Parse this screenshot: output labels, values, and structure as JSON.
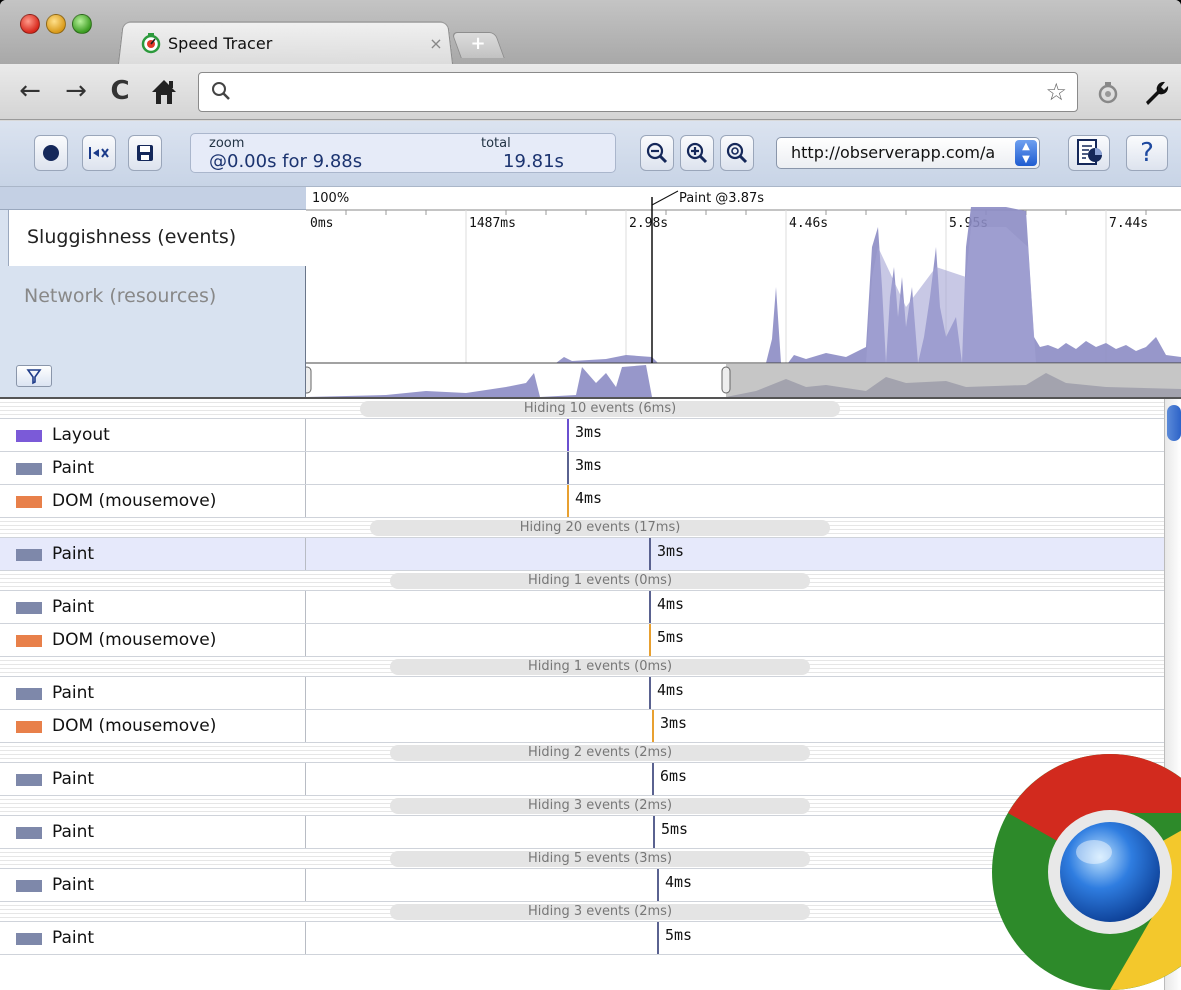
{
  "browser": {
    "tab_title": "Speed Tracer",
    "tab_close": "×",
    "new_tab": "+",
    "address_value": ""
  },
  "speedtracer": {
    "zoom_label": "zoom",
    "zoom_value": "@0.00s for 9.88s",
    "total_label": "total",
    "total_value": "19.81s",
    "url_value": "http://observerapp.com/a",
    "help_label": "?",
    "views": {
      "sluggishness": "Sluggishness (events)",
      "network": "Network (resources)"
    },
    "overview": {
      "percent_label": "100%",
      "marker_label": "Paint @3.87s",
      "ticks": [
        "0ms",
        "1487ms",
        "2.98s",
        "4.46s",
        "5.95s",
        "7.44s"
      ]
    },
    "colors": {
      "layout": "#7b5ad8",
      "paint": "#7e88aa",
      "dom": "#e8804a",
      "graph_fill": "#8c8cc4"
    }
  },
  "events": [
    {
      "kind": "hidden",
      "text": "Hiding 10 events (6ms)"
    },
    {
      "kind": "event",
      "label": "Layout",
      "type": "layout",
      "duration": "3ms",
      "at": 0.305
    },
    {
      "kind": "event",
      "label": "Paint",
      "type": "paint",
      "duration": "3ms",
      "at": 0.305
    },
    {
      "kind": "event",
      "label": "DOM (mousemove)",
      "type": "dom",
      "duration": "4ms",
      "at": 0.305
    },
    {
      "kind": "hidden",
      "text": "Hiding 20 events (17ms)"
    },
    {
      "kind": "event",
      "label": "Paint",
      "type": "paint",
      "duration": "3ms",
      "at": 0.4,
      "selected": true
    },
    {
      "kind": "hidden",
      "text": "Hiding 1 events (0ms)"
    },
    {
      "kind": "event",
      "label": "Paint",
      "type": "paint",
      "duration": "4ms",
      "at": 0.4
    },
    {
      "kind": "event",
      "label": "DOM (mousemove)",
      "type": "dom",
      "duration": "5ms",
      "at": 0.4
    },
    {
      "kind": "hidden",
      "text": "Hiding 1 events (0ms)"
    },
    {
      "kind": "event",
      "label": "Paint",
      "type": "paint",
      "duration": "4ms",
      "at": 0.4
    },
    {
      "kind": "event",
      "label": "DOM (mousemove)",
      "type": "dom",
      "duration": "3ms",
      "at": 0.404
    },
    {
      "kind": "hidden",
      "text": "Hiding 2 events (2ms)"
    },
    {
      "kind": "event",
      "label": "Paint",
      "type": "paint",
      "duration": "6ms",
      "at": 0.404
    },
    {
      "kind": "hidden",
      "text": "Hiding 3 events (2ms)"
    },
    {
      "kind": "event",
      "label": "Paint",
      "type": "paint",
      "duration": "5ms",
      "at": 0.405
    },
    {
      "kind": "hidden",
      "text": "Hiding 5 events (3ms)"
    },
    {
      "kind": "event",
      "label": "Paint",
      "type": "paint",
      "duration": "4ms",
      "at": 0.41
    },
    {
      "kind": "hidden",
      "text": "Hiding 3 events (2ms)"
    },
    {
      "kind": "event",
      "label": "Paint",
      "type": "paint",
      "duration": "5ms",
      "at": 0.41
    }
  ]
}
